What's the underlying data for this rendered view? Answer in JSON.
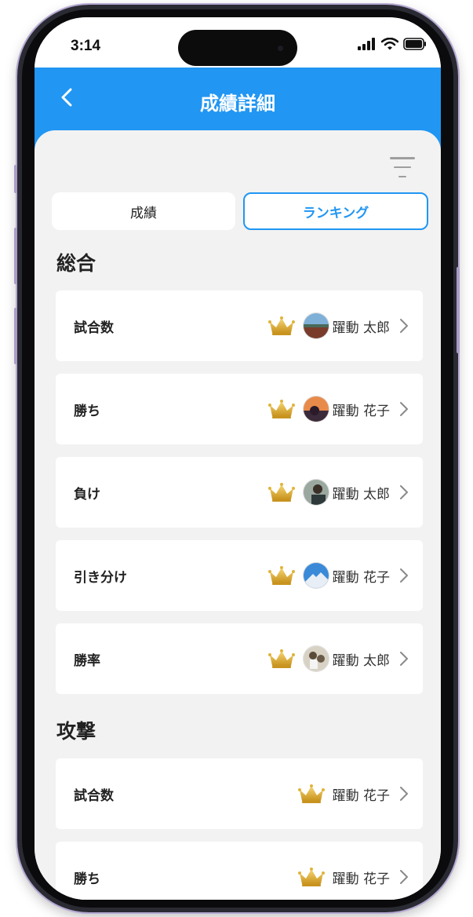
{
  "status_bar": {
    "time": "3:14"
  },
  "header": {
    "title": "成績詳細"
  },
  "tabs": [
    {
      "label": "成績",
      "active": false
    },
    {
      "label": "ランキング",
      "active": true
    }
  ],
  "sections": [
    {
      "title": "総合",
      "rows": [
        {
          "label": "試合数",
          "name": "躍動 太郎",
          "avatar": "landscape-photo"
        },
        {
          "label": "勝ち",
          "name": "躍動 花子",
          "avatar": "sunset-photo"
        },
        {
          "label": "負け",
          "name": "躍動 太郎",
          "avatar": "person-photo"
        },
        {
          "label": "引き分け",
          "name": "躍動 花子",
          "avatar": "mountain-photo"
        },
        {
          "label": "勝率",
          "name": "躍動 太郎",
          "avatar": "sports-photo"
        }
      ]
    },
    {
      "title": "攻撃",
      "rows": [
        {
          "label": "試合数",
          "name": "躍動 花子",
          "avatar": null
        },
        {
          "label": "勝ち",
          "name": "躍動 花子",
          "avatar": null
        }
      ]
    }
  ],
  "colors": {
    "accent": "#2196f3",
    "background": "#f2f2f2",
    "crown": "#e0b43a"
  },
  "icons": [
    "back-arrow-icon",
    "filter-icon",
    "crown-icon",
    "chevron-right-icon",
    "signal-icon",
    "wifi-icon",
    "battery-icon"
  ]
}
